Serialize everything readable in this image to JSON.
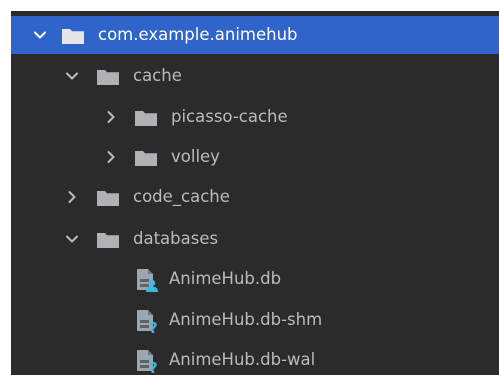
{
  "tree": {
    "root": {
      "label": "com.example.animehub",
      "icon": "folder-icon",
      "expanded": true,
      "selected": true
    },
    "cache": {
      "label": "cache",
      "icon": "folder-icon",
      "expanded": true
    },
    "picasso_cache": {
      "label": "picasso-cache",
      "icon": "folder-icon",
      "expanded": false
    },
    "volley": {
      "label": "volley",
      "icon": "folder-icon",
      "expanded": false
    },
    "code_cache": {
      "label": "code_cache",
      "icon": "folder-icon",
      "expanded": false
    },
    "databases": {
      "label": "databases",
      "icon": "folder-icon",
      "expanded": true
    },
    "animehub_db": {
      "label": "AnimeHub.db",
      "icon": "database-user-icon"
    },
    "animehub_db_shm": {
      "label": "AnimeHub.db-shm",
      "icon": "database-unknown-icon"
    },
    "animehub_db_wal": {
      "label": "AnimeHub.db-wal",
      "icon": "database-unknown-icon"
    }
  },
  "colors": {
    "panel_bg": "#2b2b2b",
    "selection": "#2f65ca",
    "text": "#bbbbbb",
    "folder": "#afb1b3",
    "question_badge": "#40b6e0"
  }
}
